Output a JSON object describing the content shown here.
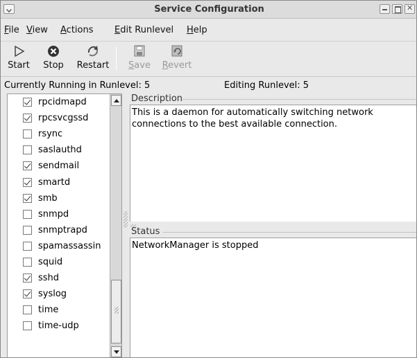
{
  "window": {
    "title": "Service Configuration"
  },
  "menubar": {
    "file": {
      "label": "File",
      "accel": "F",
      "rest": "ile"
    },
    "view": {
      "label": "View",
      "accel": "V",
      "rest": "iew"
    },
    "actions": {
      "label": "Actions",
      "accel": "A",
      "rest": "ctions"
    },
    "edit_runlevel": {
      "label": "Edit Runlevel",
      "accel": "E",
      "rest": "dit Runlevel"
    },
    "help": {
      "label": "Help",
      "accel": "H",
      "rest": "elp"
    }
  },
  "toolbar": {
    "start_label": "Start",
    "stop_label": "Stop",
    "restart_label": "Restart",
    "save_accel": "S",
    "save_rest": "ave",
    "revert_accel": "R",
    "revert_rest": "evert"
  },
  "runlevel": {
    "current": "Currently Running in Runlevel: 5",
    "editing": "Editing Runlevel: 5"
  },
  "services": [
    {
      "name": "rpcidmapd",
      "checked": true
    },
    {
      "name": "rpcsvcgssd",
      "checked": true
    },
    {
      "name": "rsync",
      "checked": false
    },
    {
      "name": "saslauthd",
      "checked": false
    },
    {
      "name": "sendmail",
      "checked": true
    },
    {
      "name": "smartd",
      "checked": true
    },
    {
      "name": "smb",
      "checked": true
    },
    {
      "name": "snmpd",
      "checked": false
    },
    {
      "name": "snmptrapd",
      "checked": false
    },
    {
      "name": "spamassassin",
      "checked": false
    },
    {
      "name": "squid",
      "checked": false
    },
    {
      "name": "sshd",
      "checked": true
    },
    {
      "name": "syslog",
      "checked": true
    },
    {
      "name": "time",
      "checked": false
    },
    {
      "name": "time-udp",
      "checked": false
    }
  ],
  "description": {
    "label": "Description",
    "text": "This is a daemon for automatically switching network connections to the best available connection."
  },
  "status": {
    "label": "Status",
    "text": "NetworkManager is stopped"
  },
  "colors": {
    "window_bg": "#e9e9e9",
    "panel_bg": "#ffffff",
    "disabled_text": "#9a9a9a"
  }
}
